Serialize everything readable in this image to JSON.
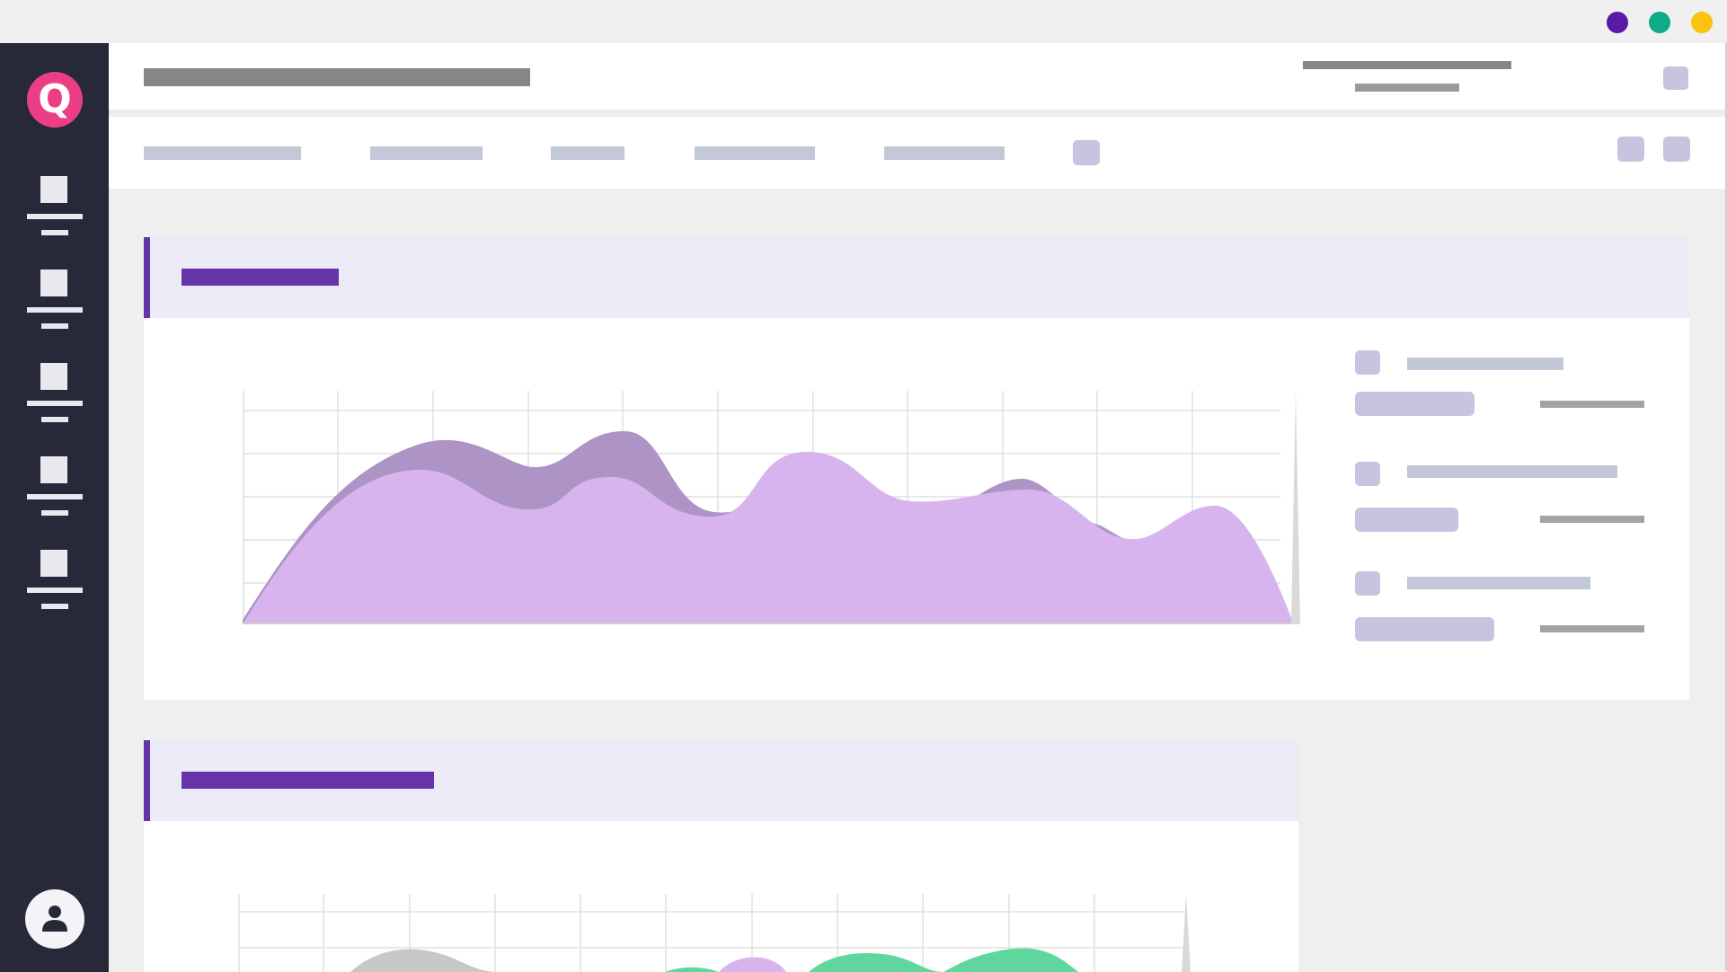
{
  "window": {
    "controls": [
      {
        "name": "purple",
        "color": "#5a1aa6"
      },
      {
        "name": "green",
        "color": "#0dab87"
      },
      {
        "name": "yellow",
        "color": "#f8c311"
      }
    ]
  },
  "brand": {
    "logo_letter": "Q",
    "color": "#ec3e85"
  },
  "sidebar": {
    "items": [
      {
        "icon": "dashboard-icon"
      },
      {
        "icon": "reports-icon"
      },
      {
        "icon": "analytics-icon"
      },
      {
        "icon": "documents-icon"
      },
      {
        "icon": "settings-icon"
      }
    ],
    "user_icon": "user-avatar-icon"
  },
  "colors": {
    "accent": "#6434a8",
    "area_primary": "#d8b4ee",
    "area_secondary": "#ae93c5",
    "green_series": "#5fd79c",
    "gray_series": "#c7c7c7"
  },
  "main_chart": {
    "legend_items": 3
  }
}
